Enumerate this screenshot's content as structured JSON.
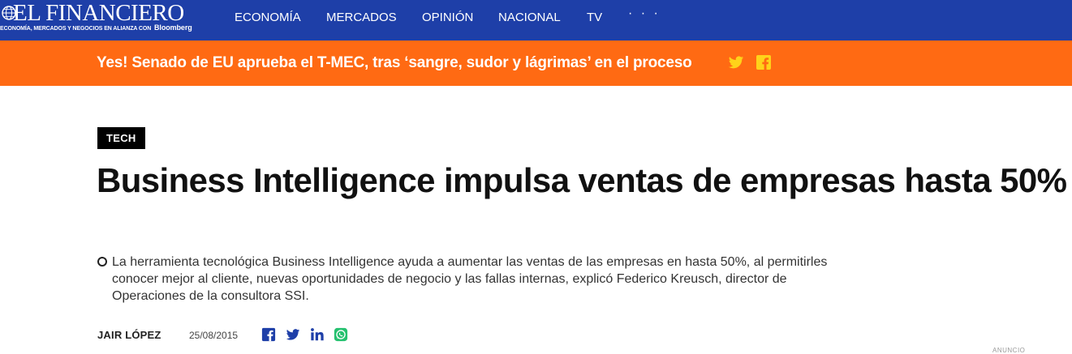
{
  "header": {
    "logo_title": "EL FINANCIERO",
    "logo_tagline": "ECONOMÍA, MERCADOS Y NEGOCIOS EN ALIANZA CON",
    "logo_partner": "Bloomberg",
    "nav": [
      {
        "label": "ECONOMÍA"
      },
      {
        "label": "MERCADOS"
      },
      {
        "label": "OPINIÓN"
      },
      {
        "label": "NACIONAL"
      },
      {
        "label": "TV"
      }
    ],
    "more_label": "· · ·"
  },
  "banner": {
    "text": "Yes! Senado de EU aprueba el T-MEC, tras ‘sangre, sudor y lágrimas’ en el proceso",
    "icons": [
      "twitter-icon",
      "facebook-icon"
    ]
  },
  "article": {
    "section_tag": "TECH",
    "headline": "Business Intelligence impulsa ventas de empresas hasta 50%",
    "summary": "La herramienta tecnológica Business Intelligence ayuda a aumentar las ventas de las empresas en hasta 50%, al permitirles conocer mejor al cliente, nuevas oportunidades de negocio y las fallas internas, explicó Federico Kreusch, director de Operaciones de la consultora SSI.",
    "author": "JAIR LÓPEZ",
    "date": "25/08/2015",
    "share_icons": [
      "facebook-icon",
      "twitter-icon",
      "linkedin-icon",
      "whatsapp-icon"
    ]
  },
  "ad_label": "ANUNCIO",
  "colors": {
    "nav_bg": "#1e3fa8",
    "banner_bg": "#ff6a13",
    "banner_icon": "#ffd21a",
    "share_blue": "#1e3fa8",
    "whatsapp_green": "#25c16f",
    "tag_bg": "#000000"
  }
}
